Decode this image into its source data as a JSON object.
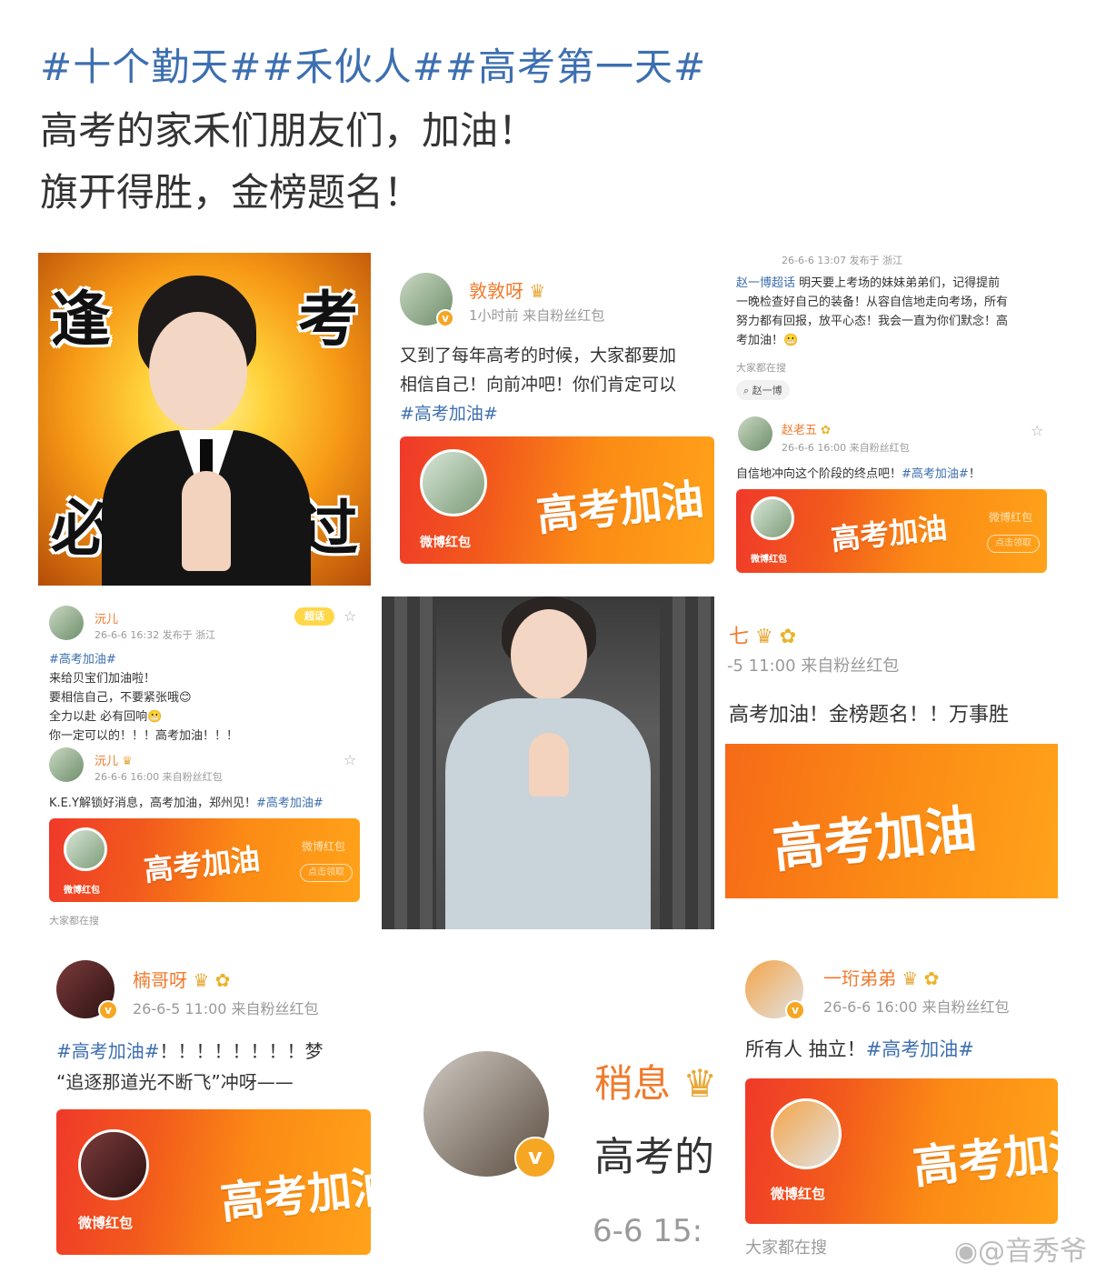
{
  "post": {
    "hashtags": "#十个勤天##禾伙人##高考第一天#",
    "line1": "高考的家禾们朋友们，加油！",
    "line2": "旗开得胜，金榜题名！"
  },
  "meme": {
    "top_left": "逢",
    "top_right": "考",
    "bottom_left": "必",
    "bottom_right": "过"
  },
  "post_dundun": {
    "username": "敦敦呀",
    "meta": "1小时前  来自粉丝红包",
    "text1": "又到了每年高考的时候，大家都要加",
    "text2": "相信自己！向前冲吧！你们肯定可以",
    "tag": "#高考加油#",
    "rp_label": "微博红包",
    "rp_title": "高考加油"
  },
  "post_zhao": {
    "meta_top": "26-6-6 13:07  发布于 浙江",
    "supertopic": "赵一博超话",
    "text1": " 明天要上考场的妹妹弟弟们，记得提前",
    "text2": "一晚检查好自己的装备！从容自信地走向考场，所有",
    "text3": "努力都有回报，放平心态！我会一直为你们默念！高",
    "text4": "考加油！😬",
    "search_label": "大家都在搜",
    "search_chip": "赵一博",
    "username": "赵老五",
    "meta": "26-6-6 16:00  来自粉丝红包",
    "text_main": "自信地冲向这个阶段的终点吧！",
    "tag": "#高考加油#",
    "text_end": "！",
    "rp_label": "微博红包",
    "rp_title": "高考加油",
    "rp_side": "微博红包",
    "rp_btn": "点击领取"
  },
  "post_yuaner": {
    "username": "沅儿",
    "meta": "26-6-6 16:32  发布于 浙江",
    "sticker": "超话",
    "tag": "#高考加油#",
    "text1": "来给贝宝们加油啦！",
    "text2": "要相信自己，不要紧张哦😊",
    "text3": "全力以赴 必有回响😬",
    "text4": "你一定可以的！！！高考加油！！！",
    "username2": "沅儿",
    "meta2": "26-6-6 16:00  来自粉丝红包",
    "text5": "K.E.Y解锁好消息，高考加油，郑州见！",
    "tag2": "#高考加油#",
    "rp_label": "微博红包",
    "rp_title": "高考加油",
    "rp_side": "微博红包",
    "rp_btn": "点击领取",
    "search_label": "大家都在搜"
  },
  "post_qi": {
    "username": "七",
    "meta": "-5 11:00  来自粉丝红包",
    "text": "高考加油！金榜题名！！万事胜",
    "rp_title": "高考加油"
  },
  "post_nange": {
    "username": "楠哥呀",
    "meta": "26-6-5 11:00  来自粉丝红包",
    "tag": "#高考加油#",
    "text1": "！！！！！！！！梦",
    "text2": "“追逐那道光不断飞”冲呀——",
    "rp_label": "微博红包",
    "rp_title": "高考加油"
  },
  "post_shaoxi": {
    "username": "稍息",
    "text": "高考的",
    "time": "6-6 15:"
  },
  "post_yiheng": {
    "username": "一珩弟弟",
    "meta": "26-6-6 16:00  来自粉丝红包",
    "text": "所有人 抽立！",
    "tag": "#高考加油#",
    "rp_label": "微博红包",
    "rp_title": "高考加油",
    "search_label": "大家都在搜"
  },
  "watermark": "@音秀爷",
  "icons": [
    "verified-v-icon",
    "crown-icon",
    "sunflower-icon",
    "star-icon",
    "search-icon",
    "weibo-logo-icon"
  ]
}
